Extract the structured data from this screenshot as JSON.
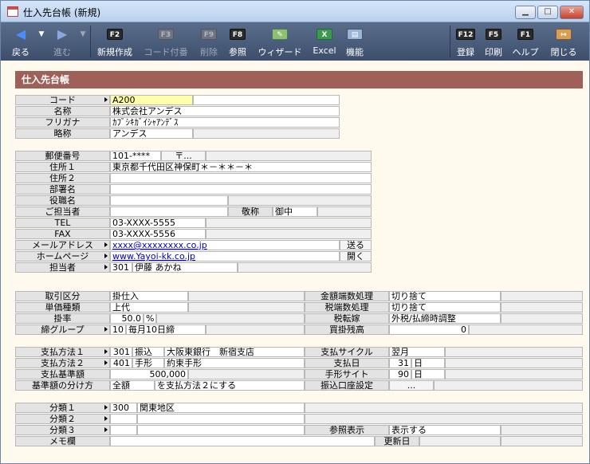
{
  "window": {
    "title": "仕入先台帳 (新規)"
  },
  "toolbar": {
    "back": "戻る",
    "forward": "進む",
    "new": "新規作成",
    "code": "コード付番",
    "del": "削除",
    "ref": "参照",
    "wizard": "ウィザード",
    "excel": "Excel",
    "func": "機能",
    "register": "登録",
    "print": "印刷",
    "help": "ヘルプ",
    "close": "閉じる",
    "f2": "F2",
    "f3": "F3",
    "f9": "F9",
    "f8": "F8",
    "f12": "F12",
    "f5": "F5",
    "f1": "F1"
  },
  "section": {
    "title": "仕入先台帳"
  },
  "basic": {
    "code_label": "コード",
    "code": "A200",
    "name_label": "名称",
    "name": "株式会社アンデス",
    "kana_label": "フリガナ",
    "kana": "ｶﾌﾞｼｷｶﾞｲｼｬｱﾝﾃﾞｽ",
    "short_label": "略称",
    "short": "アンデス"
  },
  "address": {
    "zip_label": "郵便番号",
    "zip": "101-****",
    "zip_btn": "〒...",
    "addr1_label": "住所１",
    "addr1": "東京都千代田区神保町＊－＊＊－＊",
    "addr2_label": "住所２",
    "dept_label": "部署名",
    "title_label": "役職名",
    "person_label": "ご担当者",
    "honorific_label": "敬称",
    "honorific": "御中",
    "tel_label": "TEL",
    "tel": "03-XXXX-5555",
    "fax_label": "FAX",
    "fax": "03-XXXX-5556",
    "mail_label": "メールアドレス",
    "mail": "xxxx@xxxxxxxx.co.jp",
    "mail_btn": "送る",
    "web_label": "ホームページ",
    "web": "www.Yayoi-kk.co.jp",
    "web_btn": "開く",
    "staff_label": "担当者",
    "staff_code": "301",
    "staff_name": "伊藤 あかね"
  },
  "trade": {
    "kind_label": "取引区分",
    "kind": "掛仕入",
    "price_label": "単価種類",
    "price": "上代",
    "rate_label": "掛率",
    "rate": "50.0",
    "rate_unit": "%",
    "group_label": "締グループ",
    "group_code": "10",
    "group_name": "毎月10日締",
    "round_label": "金額端数処理",
    "round": "切り捨て",
    "taxround_label": "税端数処理",
    "taxround": "切り捨て",
    "taxshift_label": "税転嫁",
    "taxshift": "外税/払締時調整",
    "balance_label": "買掛残高",
    "balance": "0"
  },
  "pay": {
    "m1_label": "支払方法１",
    "m1_code": "301",
    "m1_kind": "振込",
    "m1_bank": "大阪東銀行　新宿支店",
    "m2_label": "支払方法２",
    "m2_code": "401",
    "m2_kind": "手形",
    "m2_note": "約束手形",
    "base_label": "支払基準額",
    "base": "500,000",
    "split_label": "基準額の分け方",
    "split": "全額",
    "split_text": "を支払方法２にする",
    "cycle_label": "支払サイクル",
    "cycle": "翌月",
    "day_label": "支払日",
    "day": "31",
    "day_unit": "日",
    "site_label": "手形サイト",
    "site": "90",
    "site_unit": "日",
    "acct_label": "振込口座設定",
    "acct_btn": "..."
  },
  "cls": {
    "c1_label": "分類１",
    "c1_code": "300",
    "c1_name": "関東地区",
    "c2_label": "分類２",
    "c3_label": "分類３",
    "memo_label": "メモ欄",
    "refdisp_label": "参照表示",
    "refdisp": "表示する",
    "updated_label": "更新日"
  }
}
